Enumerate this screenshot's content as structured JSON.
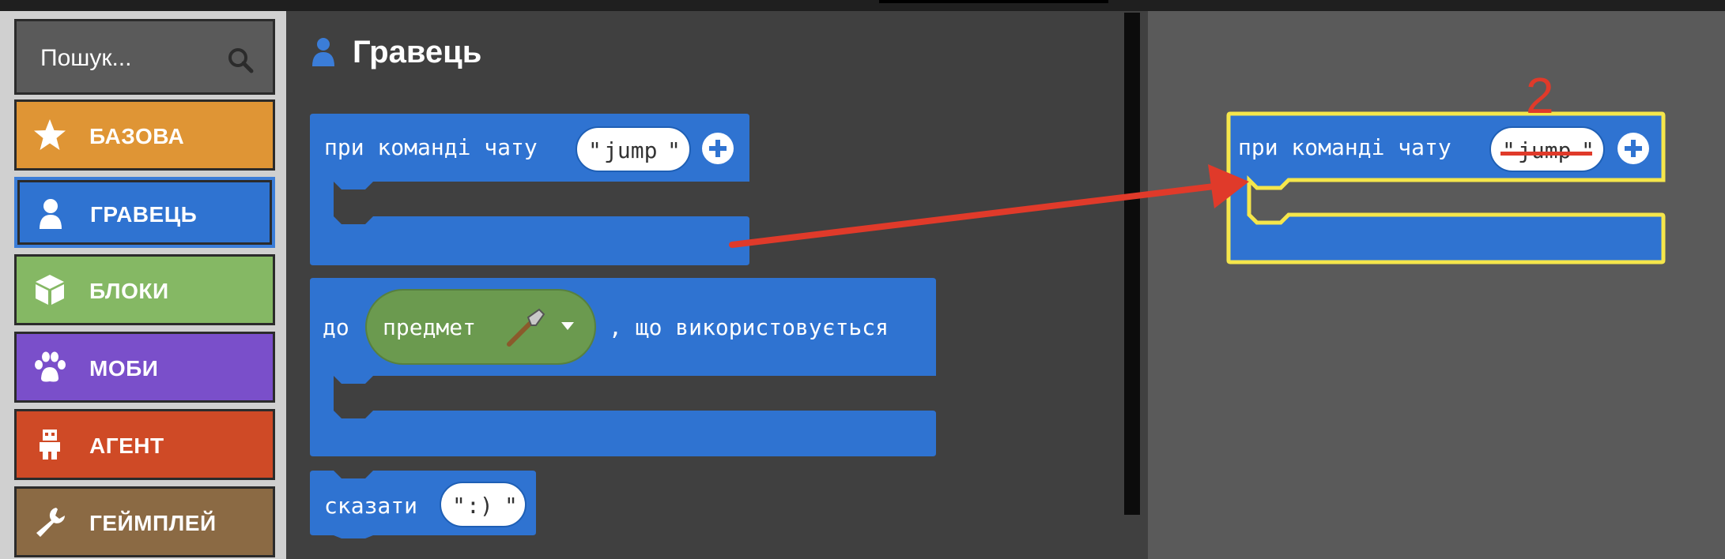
{
  "search": {
    "placeholder": "Пошук..."
  },
  "categories": [
    {
      "label": "БАЗОВА",
      "color": "#df9535",
      "icon": "star-icon"
    },
    {
      "label": "ГРАВЕЦЬ",
      "color": "#2f73d1",
      "icon": "player-icon"
    },
    {
      "label": "БЛОКИ",
      "color": "#85b864",
      "icon": "cube-icon"
    },
    {
      "label": "МОБИ",
      "color": "#7a4fca",
      "icon": "paw-icon"
    },
    {
      "label": "АГЕНТ",
      "color": "#cf4a26",
      "icon": "agent-icon"
    },
    {
      "label": "ГЕЙМПЛЕЙ",
      "color": "#8b6a44",
      "icon": "wrench-icon"
    }
  ],
  "flyout": {
    "title": "Гравець",
    "block_chat": {
      "label": "при команді чату",
      "arg": "jump"
    },
    "block_item": {
      "prefix": "до",
      "item_label": "предмет",
      "suffix": ", що використовується"
    },
    "block_say": {
      "label": "сказати",
      "arg": ":)"
    }
  },
  "workspace": {
    "annotation_number": "2",
    "block_chat": {
      "label": "при команді чату",
      "arg": "jump"
    }
  }
}
